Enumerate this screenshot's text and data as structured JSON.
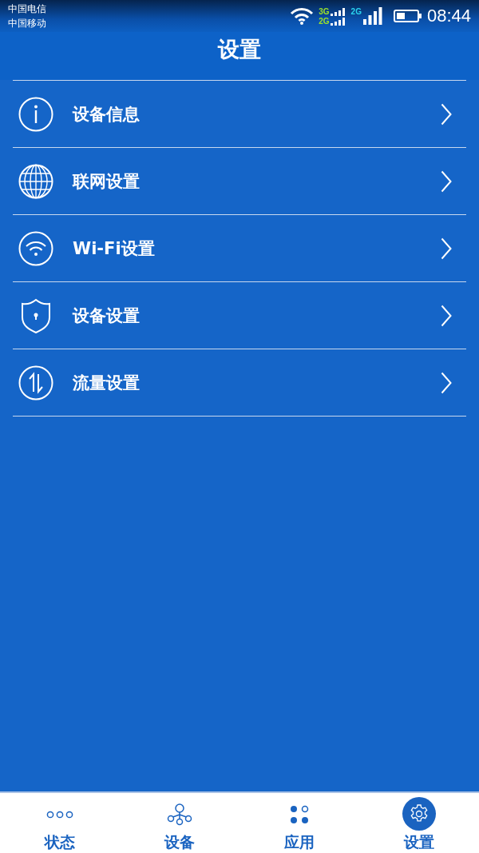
{
  "status_bar": {
    "carriers": [
      "中国电信",
      "中国移动"
    ],
    "network_labels": [
      "3G",
      "2G",
      "2G"
    ],
    "time": "08:44"
  },
  "header": {
    "title": "设置"
  },
  "menu": [
    {
      "label": "设备信息"
    },
    {
      "label": "联网设置"
    },
    {
      "label": "Wi-Fi设置"
    },
    {
      "label": "设备设置"
    },
    {
      "label": "流量设置"
    }
  ],
  "tabs": [
    {
      "label": "状态",
      "selected": false
    },
    {
      "label": "设备",
      "selected": false
    },
    {
      "label": "应用",
      "selected": false
    },
    {
      "label": "设置",
      "selected": true
    }
  ]
}
